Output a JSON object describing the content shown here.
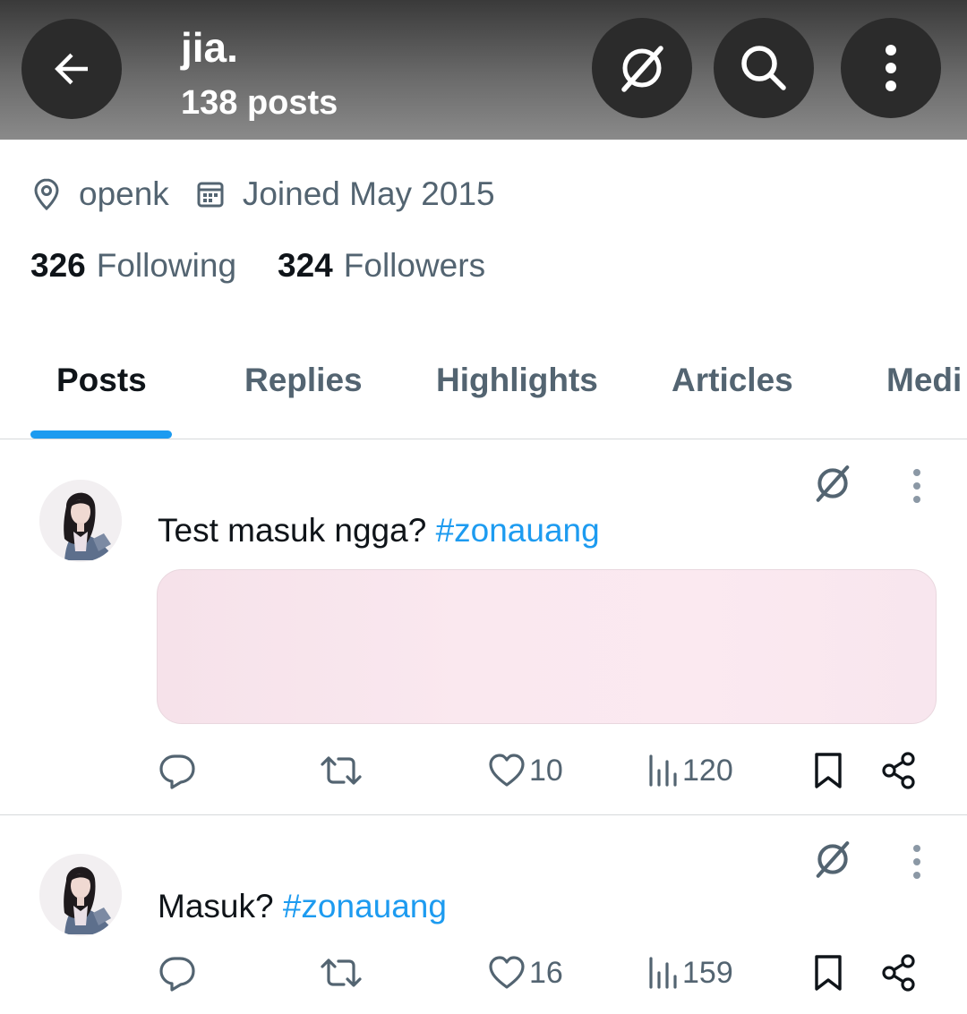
{
  "header": {
    "name": "jia.",
    "post_count": "138 posts"
  },
  "profile": {
    "location": "openk",
    "joined": "Joined May 2015",
    "following_count": "326",
    "following_label": "Following",
    "followers_count": "324",
    "followers_label": "Followers"
  },
  "tabs": [
    {
      "label": "Posts",
      "active": true
    },
    {
      "label": "Replies",
      "active": false
    },
    {
      "label": "Highlights",
      "active": false
    },
    {
      "label": "Articles",
      "active": false
    },
    {
      "label": "Medi",
      "active": false
    }
  ],
  "posts": [
    {
      "text": "Test masuk ngga?",
      "hashtag": "#zonauang",
      "likes": "10",
      "views": "120",
      "has_media": true
    },
    {
      "text": "Masuk?",
      "hashtag": "#zonauang",
      "likes": "16",
      "views": "159",
      "has_media": false
    }
  ],
  "colors": {
    "accent": "#1d9bf0",
    "secondary_text": "#536471",
    "primary_text": "#0f1419",
    "header_button": "#2b2b2b"
  },
  "icons": [
    "back-arrow-icon",
    "grok-icon",
    "search-icon",
    "more-vertical-icon",
    "location-pin-icon",
    "calendar-icon",
    "reply-icon",
    "repost-icon",
    "like-icon",
    "views-icon",
    "bookmark-icon",
    "share-icon"
  ]
}
